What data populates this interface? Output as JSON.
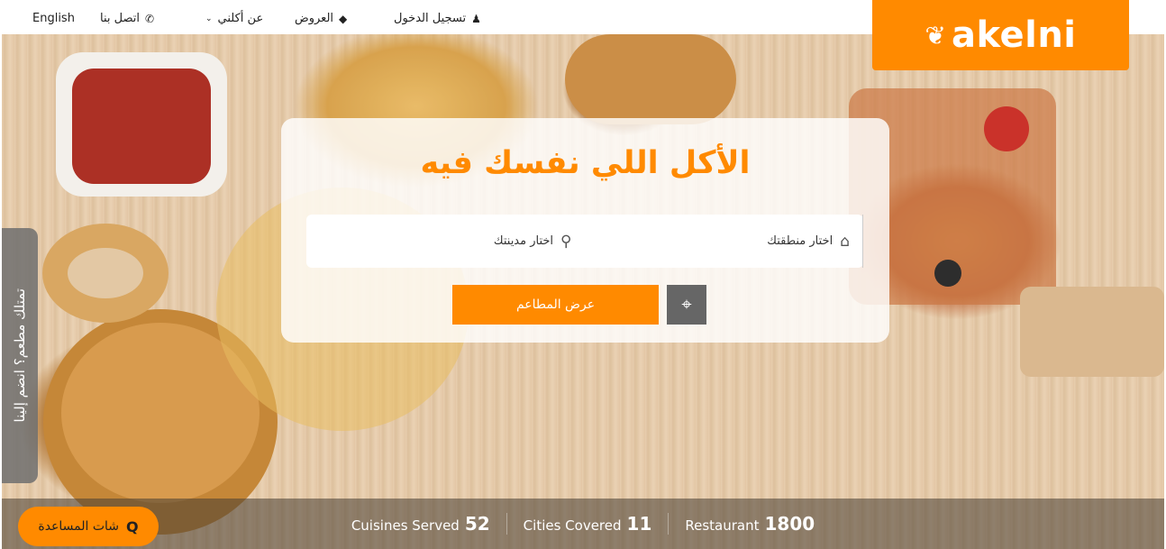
{
  "nav": {
    "login": "تسجيل الدخول",
    "offers": "العروض",
    "about": "عن أكلني",
    "contact": "اتصل بنا",
    "language": "English"
  },
  "icons": {
    "user": "user-icon",
    "tag": "tag-icon",
    "chevron": "chevron-down-icon",
    "phone": "phone-icon",
    "map_pin": "map-pin-icon",
    "home": "home-icon",
    "crosshair": "crosshair-icon",
    "search": "search-icon"
  },
  "logo": {
    "text": "akelni"
  },
  "hero": {
    "headline": "الأكل اللي نفسك فيه",
    "city_select": "اختار مدينتك",
    "area_select": "اختار منطقتك",
    "show_restaurants": "عرض المطاعم"
  },
  "side_tab": {
    "label": "تمتلك مطعم؟ انضم إلينا"
  },
  "stats": [
    {
      "label": "Cuisines Served",
      "value": "52"
    },
    {
      "label": "Cities Covered",
      "value": "11"
    },
    {
      "label": "Restaurant",
      "value": "1800"
    }
  ],
  "chat": {
    "label": "شات المساعدة"
  },
  "colors": {
    "accent": "#ff8a00",
    "locate_button": "#666666"
  }
}
